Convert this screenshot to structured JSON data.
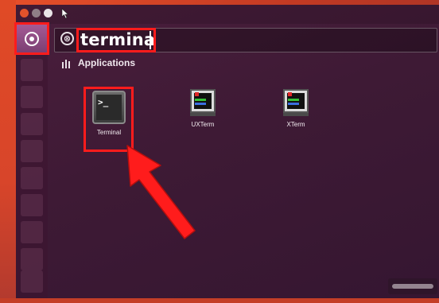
{
  "search": {
    "query": "terminal",
    "clear_symbol": "⊗"
  },
  "results": {
    "category_label": "Applications",
    "apps": [
      {
        "label": "Terminal",
        "icon": "terminal-icon"
      },
      {
        "label": "UXTerm",
        "icon": "xterm-icon"
      },
      {
        "label": "XTerm",
        "icon": "xterm-icon"
      }
    ]
  },
  "terminal_prompt": ">_",
  "icons": {
    "dash_button": "ubuntu-logo-icon",
    "pointer": "mouse-pointer-icon",
    "category": "applications-category-icon"
  },
  "colors": {
    "highlight": "#ff1c1c",
    "dash_background": "#3e1a35",
    "wallpaper": "#e04a26"
  }
}
